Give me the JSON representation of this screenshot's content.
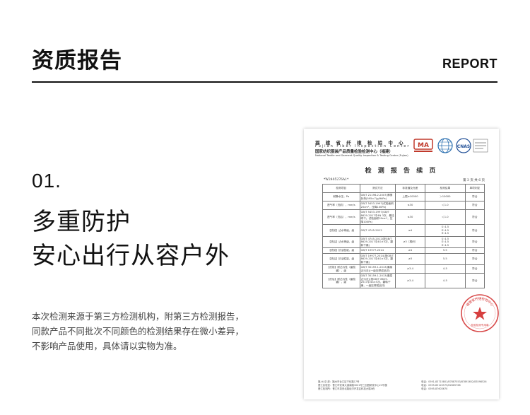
{
  "header": {
    "title": "资质报告",
    "title_en": "REPORT"
  },
  "section": {
    "number": "01.",
    "headline_1": "多重防护",
    "headline_2": "安心出行从容户外",
    "desc_lines": [
      "本次检测来源于第三方检测机构，附第三方检测报告，",
      "同款产品不同批次不同颜色的检测结果存在微小差异，",
      "不影响产品使用，具体请以实物为准。"
    ]
  },
  "certificate": {
    "org_cn": "福 建 省 纤 维 检 验 中 心",
    "org_en": "Fujian Fiber Inspection Center",
    "org_cn2": "国家纺织服装产品质量检验检测中心（福建）",
    "org_en2": "National Textile and Garment Quality Inspection & Testing Center (Fujian)",
    "logo_ma": "MA",
    "logo_cnas": "CNAS",
    "title": "检 测 报 告 续 页",
    "report_no": "*W2405276A1*",
    "page_no": "第 3 页 共 6 页",
    "headers": [
      "检测项目",
      "测试方法",
      "标准值及允差",
      "检测结果",
      "单项判定"
    ],
    "rows": [
      [
        "耐静水压，Pa",
        "GB/T 21196.2-2007(摩擦负荷(595±7)g/9kPa)",
        "上限≥10000",
        "＞10000",
        "符合"
      ],
      [
        "透气率（洗前），mm/s",
        "GB/T 5453-1997(试验面积20cm²，压降100Pa)",
        "≤30",
        "＜1.0",
        "符合"
      ],
      [
        "透气率（洗后），mm/s",
        "GB/T 5453-1997(GB/T 8629-2017中4N 3次，悬挂晾干；试验面积20cm²，压降100Pa)",
        "≤30",
        "＜1.0",
        "符合"
      ],
      [
        "【洗前】沾水等级，级",
        "GB/T 4745-2012",
        "≥4",
        "① 4-5\n② 4-5\n③ 4-5",
        "符合"
      ],
      [
        "【洗后】沾水等级，级",
        "GB/T 4745-2012(按GB/T 8629-2017中4G×5次，翻转干燥)",
        "≥3（棉织）",
        "① 4-5\n② 4-5\n③ 4-5",
        "符合"
      ],
      [
        "【洗前】抗油性能，级",
        "GB/T 19977-2014",
        "≥4",
        "5.5",
        "符合"
      ],
      [
        "【洗后】抗油性能，级",
        "GB/T 19977-2014(按GB/T 8629-2017中4G×5次，翻转干燥)",
        "≥3",
        "5.5",
        "符合"
      ],
      [
        "【洗前】耐沾污性（番茄酱），级",
        "GB/T 30159.1-2013(最易沾污法)(一级压焊成品评)",
        "≥3-4",
        "4-5",
        "符合"
      ],
      [
        "【洗后】耐沾污性（番茄酱），级",
        "GB/T 30159.1-2013(最易沾污法)(按GB/T 8629-2017中4G×5次，翻转干燥，一级压焊成品评)",
        "≥3-4",
        "4-5",
        "符合"
      ]
    ],
    "footer_left": [
      "福 州 总 部：福州市台江区宁化路17号",
      "晋江实验室：晋江市安海大道南路3001号三创园研发中心21号楼",
      "晋江检测所：晋江市泉安北路经济开发区科技大楼A栋"
    ],
    "footer_right": [
      "电话：0591-83715801/87887553/87892652/83598526",
      "电话：0595-85120579/82665768",
      "电话：0595-87603670"
    ],
    "stamp_text": "福建省纤维检验中心",
    "stamp_sub": "检验检测专用章"
  }
}
